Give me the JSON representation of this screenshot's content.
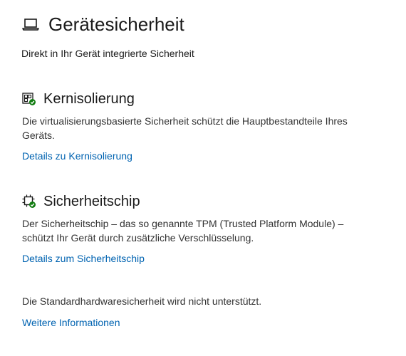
{
  "page": {
    "title": "Gerätesicherheit",
    "subtitle": "Direkt in Ihr Gerät integrierte Sicherheit",
    "icon": "laptop-icon"
  },
  "sections": [
    {
      "icon": "core-isolation-icon",
      "title": "Kernisolierung",
      "description": "Die virtualisierungsbasierte Sicherheit schützt die Hauptbestandteile Ihres Geräts.",
      "link": "Details zu Kernisolierung"
    },
    {
      "icon": "security-chip-icon",
      "title": "Sicherheitschip",
      "description": "Der Sicherheitschip – das so genannte TPM (Trusted Platform Module) – schützt Ihr Gerät durch zusätzliche Verschlüsselung.",
      "link": "Details zum Sicherheitschip"
    }
  ],
  "hardware_info": {
    "text": "Die Standardhardwaresicherheit wird nicht unterstützt.",
    "link": "Weitere Informationen"
  },
  "colors": {
    "link": "#0063b1",
    "status_ok": "#107c10",
    "text": "#1a1a1a"
  }
}
